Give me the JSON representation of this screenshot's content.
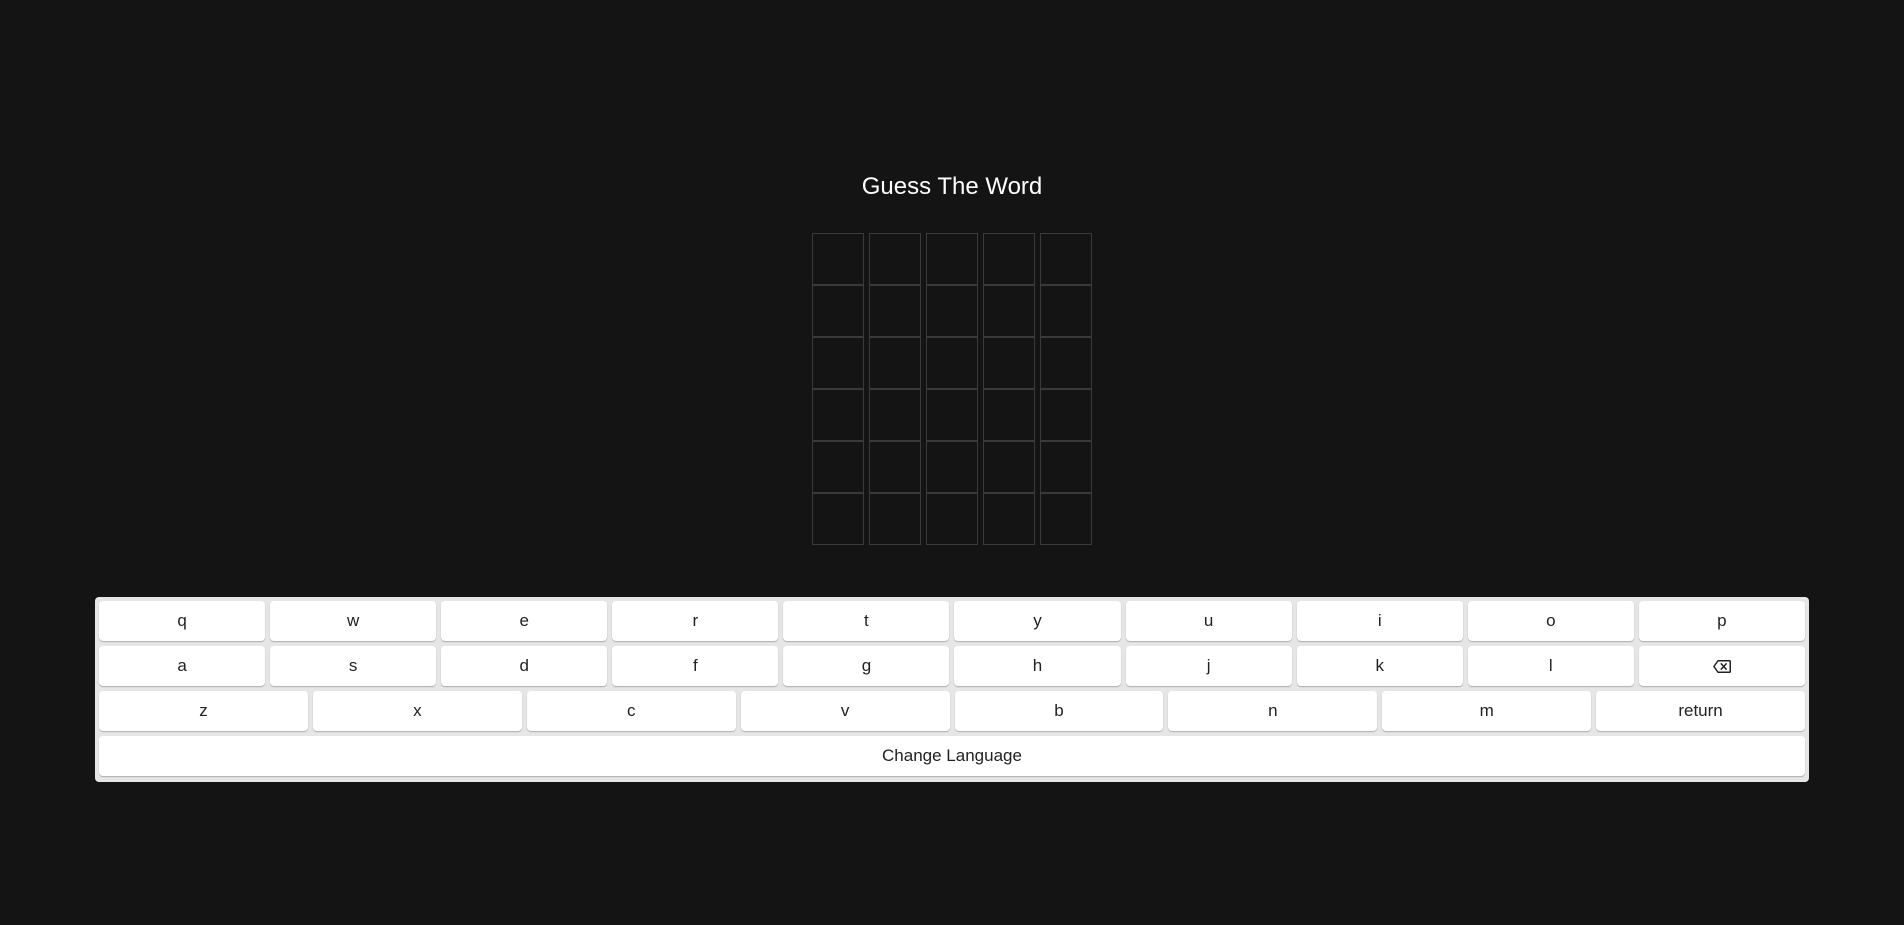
{
  "title": "Guess The Word",
  "board": {
    "rows": 6,
    "cols": 5,
    "tiles": [
      [
        "",
        "",
        "",
        "",
        ""
      ],
      [
        "",
        "",
        "",
        "",
        ""
      ],
      [
        "",
        "",
        "",
        "",
        ""
      ],
      [
        "",
        "",
        "",
        "",
        ""
      ],
      [
        "",
        "",
        "",
        "",
        ""
      ],
      [
        "",
        "",
        "",
        "",
        ""
      ]
    ]
  },
  "keyboard": {
    "row1": [
      "q",
      "w",
      "e",
      "r",
      "t",
      "y",
      "u",
      "i",
      "o",
      "p"
    ],
    "row2": [
      "a",
      "s",
      "d",
      "f",
      "g",
      "h",
      "j",
      "k",
      "l"
    ],
    "row2_backspace_icon": "backspace-icon",
    "row3": [
      "z",
      "x",
      "c",
      "v",
      "b",
      "n",
      "m"
    ],
    "return_label": "return",
    "change_language_label": "Change Language"
  },
  "colors": {
    "background": "#141414",
    "tile_border": "#3a3a3a",
    "keyboard_bg": "#e6e6e6",
    "key_bg": "#ffffff"
  }
}
